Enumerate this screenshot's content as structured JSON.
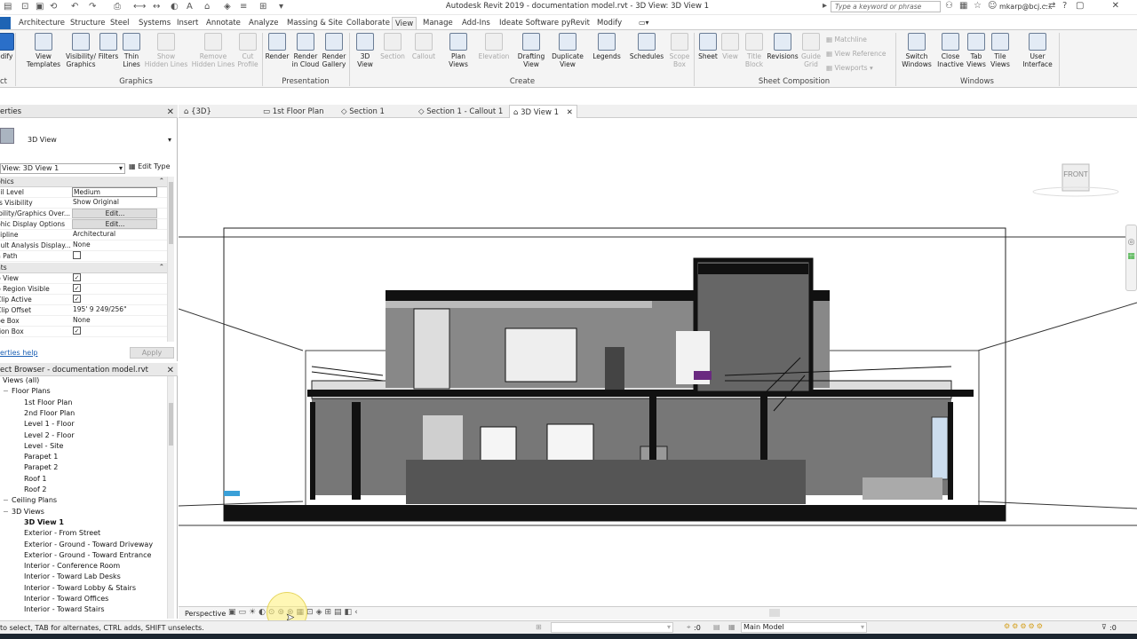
{
  "app_title": "Autodesk Revit 2019 - documentation model.rvt - 3D View: 3D View 1",
  "search_placeholder": "Type a keyword or phrase",
  "user": "mkarp@bcj.c...",
  "tabs": [
    "Architecture",
    "Structure",
    "Steel",
    "Systems",
    "Insert",
    "Annotate",
    "Analyze",
    "Massing & Site",
    "Collaborate",
    "View",
    "Manage",
    "Add-Ins",
    "Ideate Software",
    "pyRevit",
    "Modify"
  ],
  "active_tab": "View",
  "ribbon": {
    "modify": "odify",
    "graphics": [
      {
        "l": "View\nTemplates",
        "d": false
      },
      {
        "l": "Visibility/\nGraphics",
        "d": false
      },
      {
        "l": "Filters",
        "d": false
      },
      {
        "l": "Thin\nLines",
        "d": false
      },
      {
        "l": "Show\nHidden Lines",
        "d": true
      },
      {
        "l": "Remove\nHidden Lines",
        "d": true
      },
      {
        "l": "Cut\nProfile",
        "d": true
      }
    ],
    "presentation": [
      {
        "l": "Render",
        "d": false
      },
      {
        "l": "Render\nin Cloud",
        "d": false
      },
      {
        "l": "Render\nGallery",
        "d": false
      }
    ],
    "create": [
      {
        "l": "3D\nView",
        "d": false
      },
      {
        "l": "Section",
        "d": true
      },
      {
        "l": "Callout",
        "d": true
      },
      {
        "l": "Plan\nViews",
        "d": false
      },
      {
        "l": "Elevation",
        "d": true
      },
      {
        "l": "Drafting\nView",
        "d": false
      },
      {
        "l": "Duplicate\nView",
        "d": false
      },
      {
        "l": "Legends",
        "d": false
      },
      {
        "l": "Schedules",
        "d": false
      },
      {
        "l": "Scope\nBox",
        "d": true
      }
    ],
    "sheet": [
      {
        "l": "Sheet",
        "d": false
      },
      {
        "l": "View",
        "d": true
      },
      {
        "l": "Title\nBlock",
        "d": true
      },
      {
        "l": "Revisions",
        "d": false
      },
      {
        "l": "Guide\nGrid",
        "d": true
      }
    ],
    "sheet_small": [
      "Matchline",
      "View Reference",
      "Viewports"
    ],
    "windows": [
      {
        "l": "Switch\nWindows",
        "d": false
      },
      {
        "l": "Close\nInactive",
        "d": false
      },
      {
        "l": "Tab\nViews",
        "d": false
      },
      {
        "l": "Tile\nViews",
        "d": false
      },
      {
        "l": "User\nInterface",
        "d": false
      }
    ],
    "panels": {
      "select": "ct",
      "graphics": "Graphics",
      "presentation": "Presentation",
      "create": "Create",
      "sheet": "Sheet Composition",
      "windows": "Windows"
    }
  },
  "doc_tabs": [
    "{3D}",
    "1st Floor Plan",
    "Section 1",
    "Section 1 - Callout 1",
    "3D View 1"
  ],
  "properties": {
    "header": "erties",
    "type": "3D View",
    "instance": "View: 3D View 1",
    "edit_type": "Edit Type",
    "cat_graphics": "phics",
    "cat_extents": "nts",
    "rows_graphics": [
      [
        "ail Level",
        "Medium",
        "box"
      ],
      [
        "ts Visibility",
        "Show Original",
        ""
      ],
      [
        "ibility/Graphics Over...",
        "Edit...",
        "btn"
      ],
      [
        "phic Display Options",
        "Edit...",
        "btn"
      ],
      [
        "cipline",
        "Architectural",
        ""
      ],
      [
        "ault Analysis Display...",
        "None",
        ""
      ],
      [
        "n Path",
        "",
        ""
      ]
    ],
    "rows_extents": [
      [
        "p View",
        "",
        ""
      ],
      [
        "p Region Visible",
        "",
        ""
      ],
      [
        "Clip Active",
        "",
        ""
      ],
      [
        "Clip Offset",
        "195'  9 249/256\"",
        ""
      ],
      [
        "pe Box",
        "None",
        ""
      ],
      [
        "tion Box",
        "",
        ""
      ]
    ],
    "help": "erties help",
    "apply": "Apply"
  },
  "browser": {
    "header": "ect Browser - documentation model.rvt",
    "items": [
      [
        "Views (all)",
        1
      ],
      [
        "Floor Plans",
        2
      ],
      [
        "1st Floor Plan",
        3
      ],
      [
        "2nd Floor Plan",
        3
      ],
      [
        "Level 1 - Floor",
        3
      ],
      [
        "Level 2 - Floor",
        3
      ],
      [
        "Level - Site",
        3
      ],
      [
        "Parapet 1",
        3
      ],
      [
        "Parapet 2",
        3
      ],
      [
        "Roof 1",
        3
      ],
      [
        "Roof 2",
        3
      ],
      [
        "Ceiling Plans",
        2
      ],
      [
        "3D Views",
        2
      ],
      [
        "3D View 1",
        3
      ],
      [
        "Exterior - From Street",
        3
      ],
      [
        "Exterior - Ground - Toward Driveway",
        3
      ],
      [
        "Exterior - Ground - Toward Entrance",
        3
      ],
      [
        "Interior - Conference Room",
        3
      ],
      [
        "Interior - Toward Lab Desks",
        3
      ],
      [
        "Interior - Toward Lobby & Stairs",
        3
      ],
      [
        "Interior - Toward Offices",
        3
      ],
      [
        "Interior - Toward Stairs",
        3
      ]
    ]
  },
  "viewcube": "FRONT",
  "view_control": "Perspective",
  "status_text": "to select, TAB for alternates, CTRL adds, SHIFT unselects.",
  "status_zero": ":0",
  "main_model": "Main Model",
  "filter_count": ":0"
}
